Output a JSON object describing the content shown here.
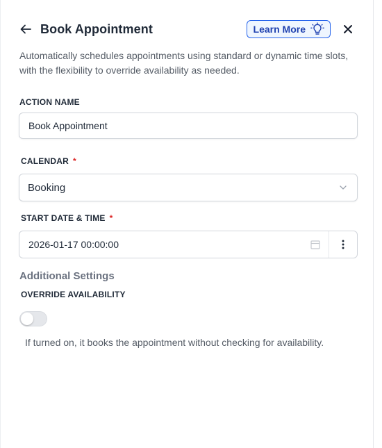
{
  "header": {
    "title": "Book Appointment",
    "learn_more_label": "Learn More",
    "icons": {
      "back": "arrow-left-icon",
      "bulb": "lightbulb-icon",
      "close": "close-icon"
    }
  },
  "description": "Automatically schedules appointments using standard or dynamic time slots, with the flexibility to override availability as needed.",
  "fields": {
    "action_name": {
      "label": "ACTION NAME",
      "value": "Book Appointment"
    },
    "calendar": {
      "label": "CALENDAR",
      "required_mark": "*",
      "selected": "Booking",
      "icon": "chevron-down-icon"
    },
    "start": {
      "label": "START DATE & TIME",
      "required_mark": "*",
      "value": "2026-01-17 00:00:00",
      "icons": {
        "calendar": "calendar-icon",
        "more": "more-vertical-icon"
      }
    }
  },
  "additional": {
    "title": "Additional Settings",
    "override_label": "OVERRIDE AVAILABILITY",
    "override_on": false,
    "hint": "If turned on, it books the appointment without checking for availability."
  },
  "colors": {
    "accent": "#2563eb",
    "required": "#dc2626",
    "border": "#d1d5db"
  }
}
